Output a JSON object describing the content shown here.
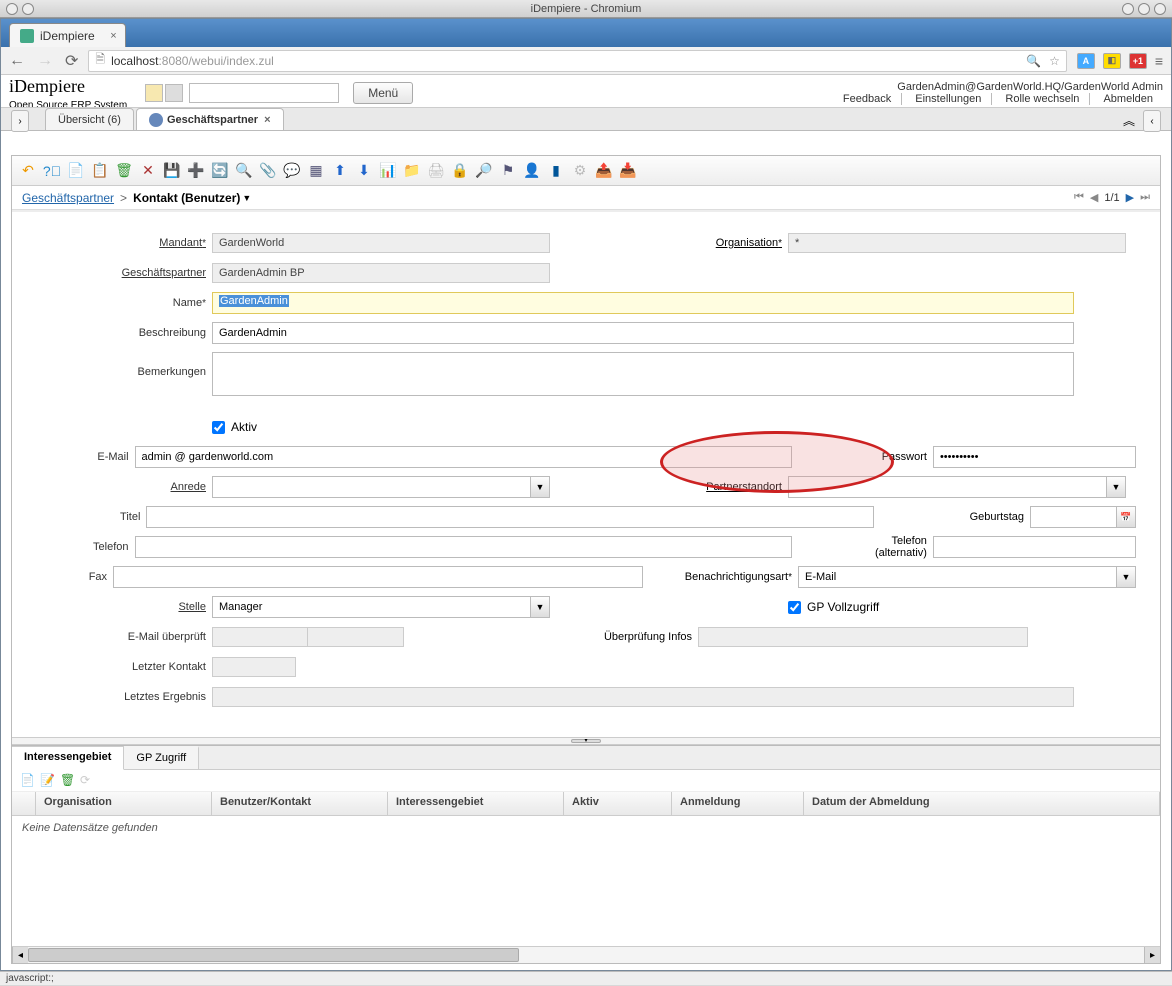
{
  "os": {
    "title": "iDempiere - Chromium"
  },
  "browser": {
    "tab_title": "iDempiere",
    "url_host": "localhost",
    "url_port": ":8080",
    "url_path": "/webui/index.zul"
  },
  "app": {
    "logo": "iDempiere",
    "logo_sub": "Open Source   ERP System",
    "menu_button": "Menü",
    "user_context": "GardenAdmin@GardenWorld.HQ/GardenWorld Admin",
    "links": {
      "feedback": "Feedback",
      "settings": "Einstellungen",
      "switch_role": "Rolle wechseln",
      "logout": "Abmelden"
    }
  },
  "tabs": {
    "overview": "Übersicht (6)",
    "bp": "Geschäftspartner"
  },
  "breadcrumb": {
    "root": "Geschäftspartner",
    "current": "Kontakt (Benutzer)"
  },
  "pager": {
    "text": "1/1"
  },
  "form": {
    "mandant_label": "Mandant",
    "mandant_value": "GardenWorld",
    "org_label": "Organisation",
    "org_value": "*",
    "bp_label": "Geschäftspartner",
    "bp_value": "GardenAdmin BP",
    "name_label": "Name",
    "name_value": "GardenAdmin",
    "desc_label": "Beschreibung",
    "desc_value": "GardenAdmin",
    "remarks_label": "Bemerkungen",
    "remarks_value": "",
    "active_label": "Aktiv",
    "email_label": "E-Mail",
    "email_value": "admin @ gardenworld.com",
    "password_label": "Passwort",
    "password_value": "••••••••••",
    "salutation_label": "Anrede",
    "partnerloc_label": "Partnerstandort",
    "title_label": "Titel",
    "birthday_label": "Geburtstag",
    "phone_label": "Telefon",
    "phone2_label": "Telefon (alternativ)",
    "fax_label": "Fax",
    "notify_label": "Benachrichtigungsart",
    "notify_value": "E-Mail",
    "position_label": "Stelle",
    "position_value": "Manager",
    "gp_full_label": "GP Vollzugriff",
    "email_verify_label": "E-Mail überprüft",
    "verify_info_label": "Überprüfung Infos",
    "last_contact_label": "Letzter Kontakt",
    "last_result_label": "Letztes Ergebnis"
  },
  "subtabs": {
    "interest": "Interessengebiet",
    "access": "GP Zugriff"
  },
  "grid": {
    "cols": {
      "org": "Organisation",
      "user": "Benutzer/Kontakt",
      "interest": "Interessengebiet",
      "active": "Aktiv",
      "signup": "Anmeldung",
      "signoff": "Datum der Abmeldung"
    },
    "empty": "Keine Datensätze gefunden"
  },
  "status": "javascript:;"
}
